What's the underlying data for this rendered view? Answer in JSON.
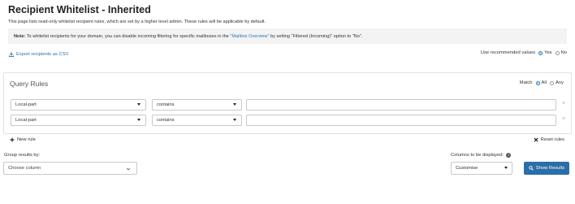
{
  "page": {
    "title": "Recipient Whitelist - Inherited",
    "description": "This page lists read-only whitelist recipient rules, which are set by a higher level admin. These rules will be applicable by default.",
    "note_label": "Note:",
    "note_text_before": " To whitelist recipients for your domain, you can disable incoming filtering for specific mailboses in the ",
    "note_link": "\"Mailbox Overview\"",
    "note_text_after": " by setting \"Filtered (Incoming)\" option to \"No\"."
  },
  "toolbar": {
    "export_label": "Export recipients as CSV",
    "recommended_label": "Use recommended values",
    "recommended_yes": "Yes",
    "recommended_no": "No",
    "recommended_selected": "Yes"
  },
  "query": {
    "title": "Query Rules",
    "match_label": "Match",
    "match_all": "All",
    "match_any": "Any",
    "match_selected": "All",
    "rules": [
      {
        "field": "Local-part",
        "operator": "contains",
        "value": ""
      },
      {
        "field": "Local-part",
        "operator": "contains",
        "value": ""
      }
    ],
    "new_rule_label": "New rule",
    "reset_rules_label": "Reset rules"
  },
  "results": {
    "group_label": "Group results by:",
    "group_value": "Choose column",
    "columns_label": "Columns to be displayed:",
    "columns_value": "Customise",
    "show_button": "Show Results"
  },
  "colors": {
    "accent": "#2b6ea8",
    "link": "#2a7ab5",
    "note_bg": "#f3f3f3",
    "border": "#c9c9c9"
  }
}
